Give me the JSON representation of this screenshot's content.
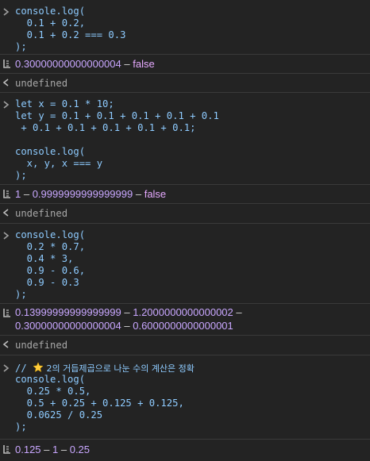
{
  "colors": {
    "background": "#232323",
    "divider": "#3a3a3a",
    "code": "#8ecbff",
    "number": "#c9a7ff",
    "boolean": "#e6a9ff",
    "undefined": "#a8a8a8"
  },
  "entries": [
    {
      "input": [
        "console.log(",
        "  0.1 + 0.2,",
        "  0.1 + 0.2 === 0.3",
        ");"
      ],
      "output": [
        "0.30000000000000004",
        " – ",
        "false"
      ],
      "return": "undefined"
    },
    {
      "input": [
        "let x = 0.1 * 10;",
        "let y = 0.1 + 0.1 + 0.1 + 0.1 + 0.1",
        " + 0.1 + 0.1 + 0.1 + 0.1 + 0.1;",
        "",
        "console.log(",
        "  x, y, x === y",
        ");"
      ],
      "output": [
        "1",
        " – ",
        "0.9999999999999999",
        " – ",
        "false"
      ],
      "return": "undefined"
    },
    {
      "input": [
        "console.log(",
        "  0.2 * 0.7,",
        "  0.4 * 3,",
        "  0.9 - 0.6,",
        "  0.9 - 0.3",
        ");"
      ],
      "output_line1": [
        "0.13999999999999999",
        " – ",
        "1.2000000000000002",
        " –"
      ],
      "output_line2": [
        "0.30000000000000004",
        " – ",
        "0.6000000000000001"
      ],
      "return": "undefined"
    },
    {
      "comment_prefix": "// ",
      "comment_text": " 2의 거듭제곱으로 나눈 수의 계산은 정확",
      "comment_icon": "star-icon",
      "input": [
        "console.log(",
        "  0.25 * 0.5,",
        "  0.5 + 0.25 + 0.125 + 0.125,",
        "  0.0625 / 0.25",
        ");"
      ],
      "output": [
        "0.125",
        " – ",
        "1",
        " – ",
        "0.25"
      ]
    }
  ]
}
